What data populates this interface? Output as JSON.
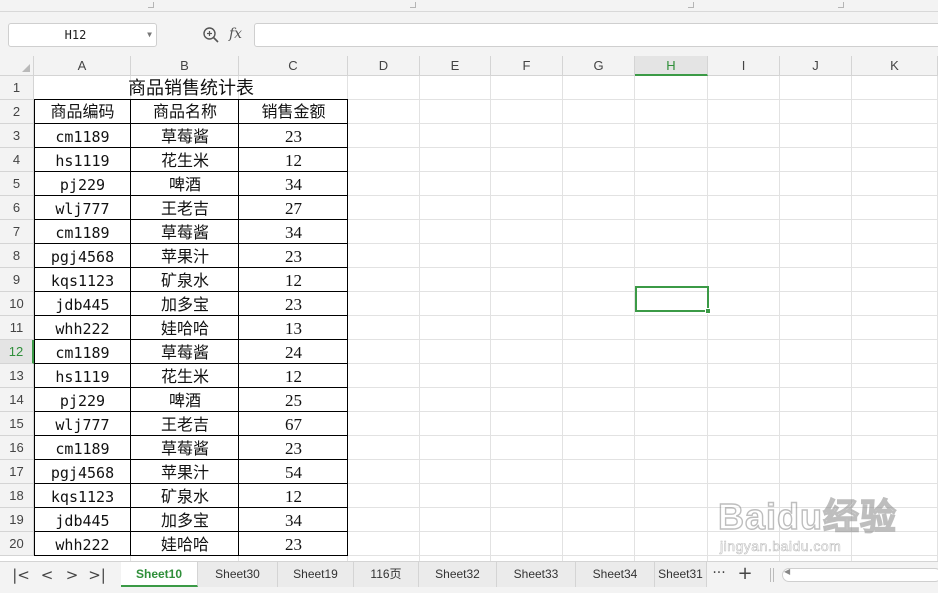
{
  "name_box": {
    "value": "H12"
  },
  "formula_bar": {
    "fx_label": "fx",
    "value": ""
  },
  "columns": [
    "A",
    "B",
    "C",
    "D",
    "E",
    "F",
    "G",
    "H",
    "I",
    "J",
    "K"
  ],
  "active_column": "H",
  "active_row": "12",
  "rows": [
    "1",
    "2",
    "3",
    "4",
    "5",
    "6",
    "7",
    "8",
    "9",
    "10",
    "11",
    "12",
    "13",
    "14",
    "15",
    "16",
    "17",
    "18",
    "19",
    "20"
  ],
  "table": {
    "title": "商品销售统计表",
    "headers": [
      "商品编码",
      "商品名称",
      "销售金额"
    ],
    "records": [
      [
        "cm1189",
        "草莓酱",
        "23"
      ],
      [
        "hs1119",
        "花生米",
        "12"
      ],
      [
        "pj229",
        "啤酒",
        "34"
      ],
      [
        "wlj777",
        "王老吉",
        "27"
      ],
      [
        "cm1189",
        "草莓酱",
        "34"
      ],
      [
        "pgj4568",
        "苹果汁",
        "23"
      ],
      [
        "kqs1123",
        "矿泉水",
        "12"
      ],
      [
        "jdb445",
        "加多宝",
        "23"
      ],
      [
        "whh222",
        "娃哈哈",
        "13"
      ],
      [
        "cm1189",
        "草莓酱",
        "24"
      ],
      [
        "hs1119",
        "花生米",
        "12"
      ],
      [
        "pj229",
        "啤酒",
        "25"
      ],
      [
        "wlj777",
        "王老吉",
        "67"
      ],
      [
        "cm1189",
        "草莓酱",
        "23"
      ],
      [
        "pgj4568",
        "苹果汁",
        "54"
      ],
      [
        "kqs1123",
        "矿泉水",
        "12"
      ],
      [
        "jdb445",
        "加多宝",
        "34"
      ],
      [
        "whh222",
        "娃哈哈",
        "23"
      ]
    ]
  },
  "sheet_tabs": [
    "Sheet10",
    "Sheet30",
    "Sheet19",
    "116页",
    "Sheet32",
    "Sheet33",
    "Sheet34",
    "Sheet31"
  ],
  "active_sheet": "Sheet10",
  "tab_nav": {
    "first": "|<",
    "prev": "<",
    "next": ">",
    "last": ">|",
    "more": "···",
    "add": "+"
  },
  "watermark": {
    "brand": "Baidu经验",
    "site": "jingyan.baidu.com"
  },
  "colors": {
    "accent_green": "#3b9a46",
    "header_bg": "#f3f3f3",
    "gridline": "#e2e2e2"
  }
}
